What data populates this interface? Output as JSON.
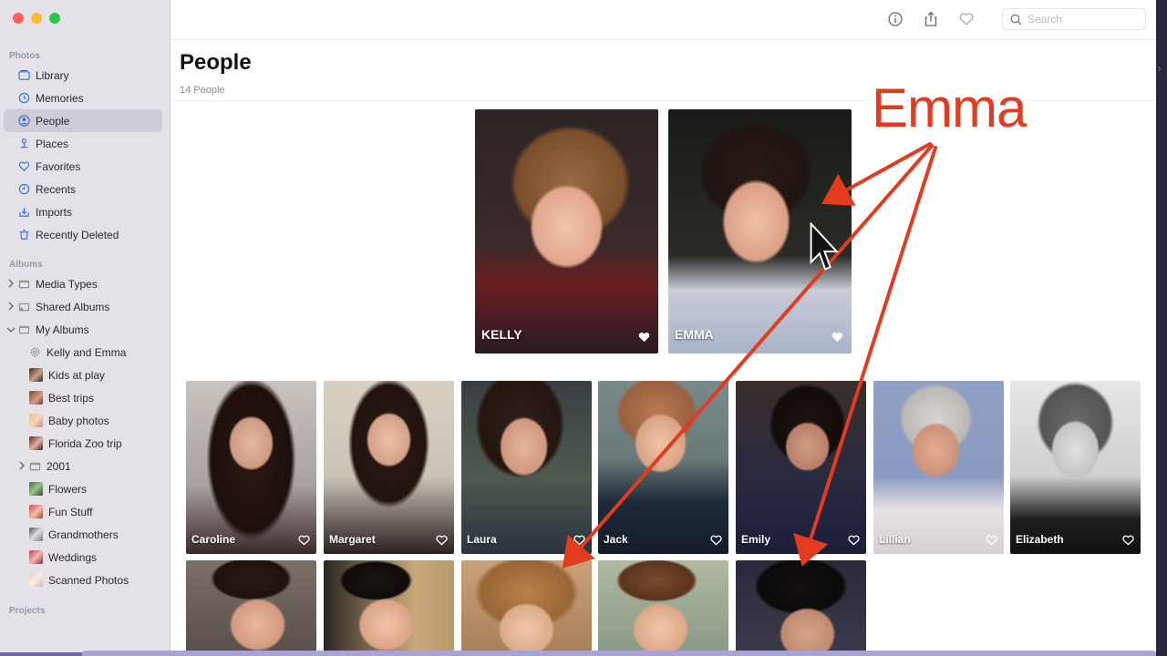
{
  "sidebar": {
    "photos_heading": "Photos",
    "photos_items": [
      {
        "label": "Library",
        "icon": "library-icon"
      },
      {
        "label": "Memories",
        "icon": "memories-icon"
      },
      {
        "label": "People",
        "icon": "people-icon",
        "active": true
      },
      {
        "label": "Places",
        "icon": "places-icon"
      },
      {
        "label": "Favorites",
        "icon": "heart-icon"
      },
      {
        "label": "Recents",
        "icon": "clock-icon"
      },
      {
        "label": "Imports",
        "icon": "import-icon"
      },
      {
        "label": "Recently Deleted",
        "icon": "trash-icon"
      }
    ],
    "albums_heading": "Albums",
    "album_items": [
      {
        "label": "Media Types"
      },
      {
        "label": "Shared Albums"
      },
      {
        "label": "My Albums"
      },
      {
        "label": "Kelly and Emma"
      },
      {
        "label": "Kids at play"
      },
      {
        "label": "Best trips"
      },
      {
        "label": "Baby photos"
      },
      {
        "label": "Florida Zoo trip"
      },
      {
        "label": "2001"
      },
      {
        "label": "Flowers"
      },
      {
        "label": "Fun Stuff"
      },
      {
        "label": "Grandmothers"
      },
      {
        "label": "Weddings"
      },
      {
        "label": "Scanned Photos"
      }
    ],
    "projects_heading": "Projects"
  },
  "toolbar": {
    "search_placeholder": "Search"
  },
  "main": {
    "title": "People",
    "subtitle": "14 People",
    "favorites": [
      {
        "name": "KELLY"
      },
      {
        "name": "EMMA"
      }
    ],
    "people_row1": [
      {
        "name": "Caroline"
      },
      {
        "name": "Margaret"
      },
      {
        "name": "Laura"
      },
      {
        "name": "Jack"
      },
      {
        "name": "Emily"
      },
      {
        "name": "Lillian"
      },
      {
        "name": "Elizabeth"
      }
    ]
  },
  "annotation": {
    "label": "Emma",
    "color": "#e33b1f"
  },
  "colors": {
    "sidebar_bg": "#e4e1e9",
    "active_item_bg": "#cfccd7",
    "accent": "#2b6fe0"
  }
}
